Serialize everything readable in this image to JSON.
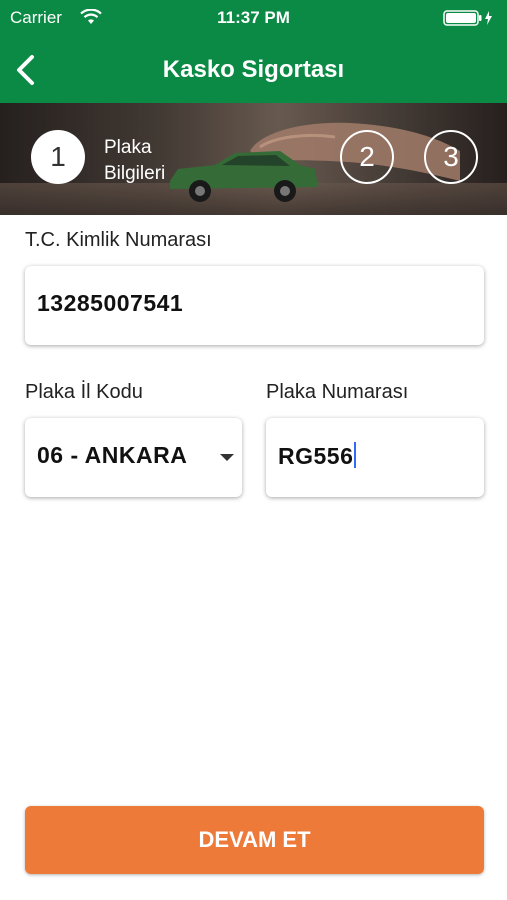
{
  "status_bar": {
    "carrier": "Carrier",
    "time": "11:37 PM",
    "wifi_icon": "wifi-icon",
    "battery_icon": "battery-charging-icon"
  },
  "nav": {
    "title": "Kasko Sigortası",
    "back_icon": "chevron-left-icon"
  },
  "steps": {
    "items": [
      {
        "number": "1",
        "label_line1": "Plaka",
        "label_line2": "Bilgileri",
        "active": true
      },
      {
        "number": "2",
        "active": false
      },
      {
        "number": "3",
        "active": false
      }
    ]
  },
  "form": {
    "tc": {
      "label": "T.C. Kimlik Numarası",
      "value": "13285007541"
    },
    "plate_city": {
      "label": "Plaka İl Kodu",
      "value": "06 - ANKARA"
    },
    "plate_number": {
      "label": "Plaka Numarası",
      "value": "RG556"
    }
  },
  "actions": {
    "continue_label": "DEVAM ET"
  },
  "colors": {
    "header_green": "#0a8a44",
    "button_orange": "#ee7a3a",
    "caret_blue": "#2f6df6"
  }
}
